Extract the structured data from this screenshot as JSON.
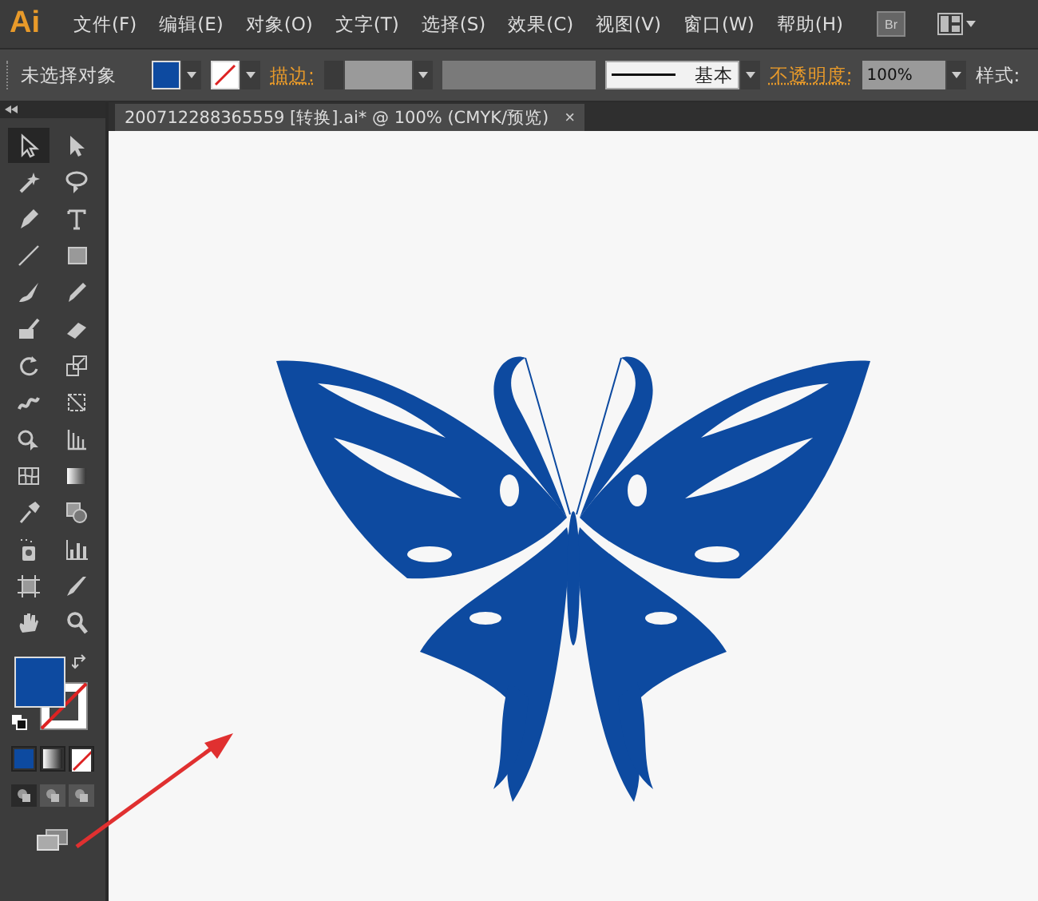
{
  "app_logo": "Ai",
  "menu": [
    "文件(F)",
    "编辑(E)",
    "对象(O)",
    "文字(T)",
    "选择(S)",
    "效果(C)",
    "视图(V)",
    "窗口(W)",
    "帮助(H)"
  ],
  "bridge_button": "Br",
  "control_bar": {
    "selection_status": "未选择对象",
    "stroke_label": "描边:",
    "stroke_profile": "基本",
    "opacity_label": "不透明度:",
    "opacity": "100%",
    "style_label": "样式:"
  },
  "document_tab": {
    "title": "200712288365559  [转换].ai* @ 100% (CMYK/预览)",
    "close": "×"
  },
  "tools": [
    {
      "kind": "selection",
      "selected": true
    },
    {
      "kind": "direct-selection",
      "selected": false
    },
    {
      "kind": "magic-wand",
      "selected": false
    },
    {
      "kind": "lasso",
      "selected": false
    },
    {
      "kind": "pen",
      "selected": false
    },
    {
      "kind": "type",
      "selected": false
    },
    {
      "kind": "line",
      "selected": false
    },
    {
      "kind": "rectangle",
      "selected": false
    },
    {
      "kind": "paintbrush",
      "selected": false
    },
    {
      "kind": "pencil",
      "selected": false
    },
    {
      "kind": "blob-brush",
      "selected": false
    },
    {
      "kind": "eraser",
      "selected": false
    },
    {
      "kind": "rotate",
      "selected": false
    },
    {
      "kind": "scale",
      "selected": false
    },
    {
      "kind": "warp",
      "selected": false
    },
    {
      "kind": "free-transform",
      "selected": false
    },
    {
      "kind": "shape-builder",
      "selected": false
    },
    {
      "kind": "perspective-grid",
      "selected": false
    },
    {
      "kind": "mesh",
      "selected": false
    },
    {
      "kind": "gradient",
      "selected": false
    },
    {
      "kind": "eyedropper",
      "selected": false
    },
    {
      "kind": "blend",
      "selected": false
    },
    {
      "kind": "symbol-sprayer",
      "selected": false
    },
    {
      "kind": "column-graph",
      "selected": false
    },
    {
      "kind": "artboard",
      "selected": false
    },
    {
      "kind": "slice",
      "selected": false
    },
    {
      "kind": "hand",
      "selected": false
    },
    {
      "kind": "zoom",
      "selected": false
    }
  ],
  "draw_modes": [
    {
      "selected": true
    },
    {
      "selected": false
    },
    {
      "selected": false
    }
  ]
}
